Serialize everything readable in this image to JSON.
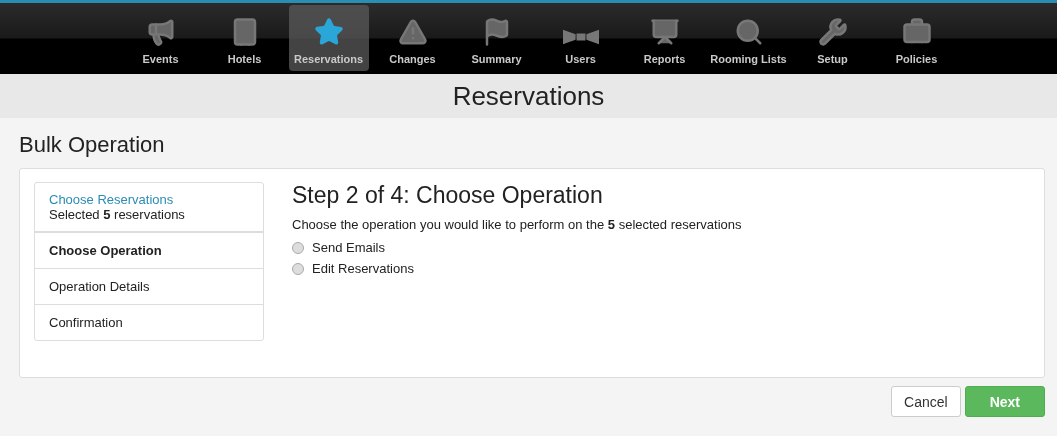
{
  "nav": [
    {
      "label": "Events",
      "selected": false
    },
    {
      "label": "Hotels",
      "selected": false
    },
    {
      "label": "Reservations",
      "selected": true
    },
    {
      "label": "Changes",
      "selected": false
    },
    {
      "label": "Summary",
      "selected": false
    },
    {
      "label": "Users",
      "selected": false
    },
    {
      "label": "Reports",
      "selected": false
    },
    {
      "label": "Rooming Lists",
      "selected": false
    },
    {
      "label": "Setup",
      "selected": false
    },
    {
      "label": "Policies",
      "selected": false
    }
  ],
  "page_title": "Reservations",
  "section_title": "Bulk Operation",
  "steps": [
    {
      "title": "Choose Reservations",
      "subtitle": "Selected **5** reservations",
      "completed": true,
      "selected": false
    },
    {
      "title": "Choose Operation",
      "completed": false,
      "selected": true
    },
    {
      "title": "Operation Details",
      "completed": false,
      "selected": false
    },
    {
      "title": "Confirmation",
      "completed": false,
      "selected": false
    }
  ],
  "step_heading": "Step 2 of 4: Choose Operation",
  "instruction": "Choose the operation you would like to perform on the **5** selected reservations",
  "options": [
    {
      "label": "Send Emails",
      "selected": false
    },
    {
      "label": "Edit Reservations",
      "selected": false
    }
  ],
  "buttons": {
    "cancel": "Cancel",
    "next": "Next"
  }
}
